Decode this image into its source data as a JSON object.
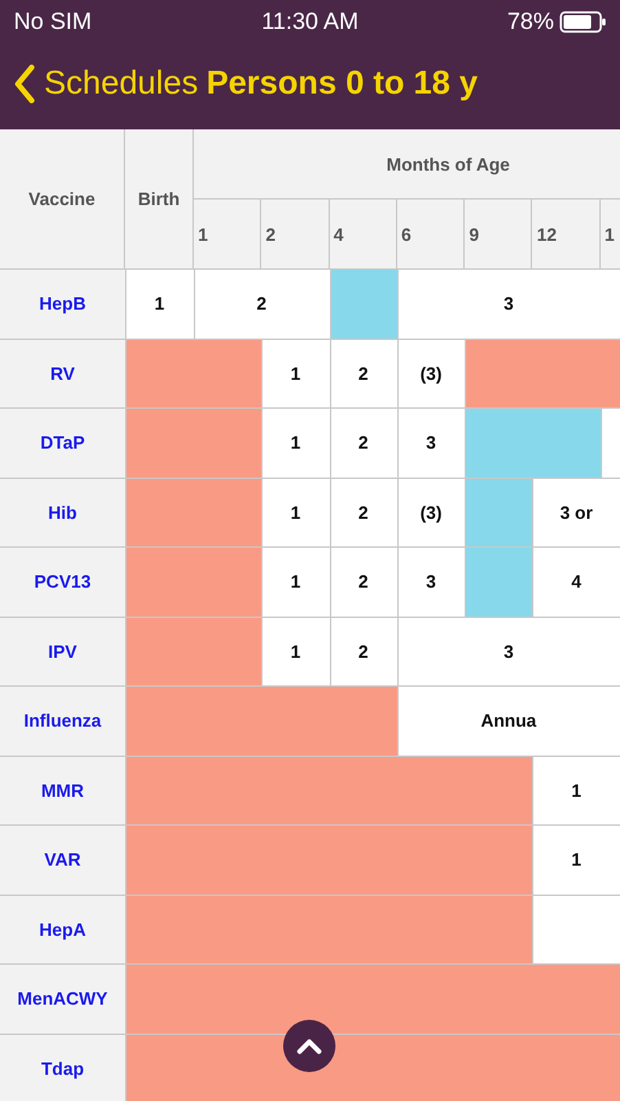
{
  "status_bar": {
    "carrier": "No SIM",
    "time": "11:30 AM",
    "battery": "78%"
  },
  "nav_bar": {
    "back_label": "Schedules",
    "title": "Persons 0 to 18 y"
  },
  "table": {
    "columns": {
      "vaccine": "Vaccine",
      "birth": "Birth",
      "months_heading": "Months of Age",
      "months": [
        "1",
        "2",
        "4",
        "6",
        "9",
        "12",
        "1"
      ]
    },
    "rows": [
      {
        "vaccine": "HepB",
        "cells": [
          {
            "kind": "dose",
            "joined": false,
            "text": "1"
          },
          {
            "kind": "dose",
            "joined": false,
            "text": "2"
          },
          {
            "kind": "dose",
            "joined": true
          },
          {
            "kind": "catchup",
            "joined": false
          },
          {
            "kind": "dose",
            "joined": false,
            "text": "3"
          },
          {
            "kind": "dose",
            "joined": true
          },
          {
            "kind": "dose",
            "joined": true
          },
          {
            "kind": "dose",
            "joined": true
          }
        ]
      },
      {
        "vaccine": "RV",
        "cells": [
          {
            "kind": "unrecommended",
            "joined": false
          },
          {
            "kind": "unrecommended",
            "joined": true
          },
          {
            "kind": "dose",
            "joined": false,
            "text": "1"
          },
          {
            "kind": "dose",
            "joined": false,
            "text": "2"
          },
          {
            "kind": "dose",
            "joined": false,
            "text": "(3)"
          },
          {
            "kind": "unrecommended",
            "joined": false
          },
          {
            "kind": "unrecommended",
            "joined": true
          },
          {
            "kind": "unrecommended",
            "joined": true
          }
        ]
      },
      {
        "vaccine": "DTaP",
        "cells": [
          {
            "kind": "unrecommended",
            "joined": false
          },
          {
            "kind": "unrecommended",
            "joined": true
          },
          {
            "kind": "dose",
            "joined": false,
            "text": "1"
          },
          {
            "kind": "dose",
            "joined": false,
            "text": "2"
          },
          {
            "kind": "dose",
            "joined": false,
            "text": "3"
          },
          {
            "kind": "catchup",
            "joined": false
          },
          {
            "kind": "catchup",
            "joined": true
          },
          {
            "kind": "dose",
            "joined": false
          }
        ]
      },
      {
        "vaccine": "Hib",
        "cells": [
          {
            "kind": "unrecommended",
            "joined": false
          },
          {
            "kind": "unrecommended",
            "joined": true
          },
          {
            "kind": "dose",
            "joined": false,
            "text": "1"
          },
          {
            "kind": "dose",
            "joined": false,
            "text": "2"
          },
          {
            "kind": "dose",
            "joined": false,
            "text": "(3)"
          },
          {
            "kind": "catchup",
            "joined": false
          },
          {
            "kind": "dose",
            "joined": false,
            "text": "3 or"
          },
          {
            "kind": "dose",
            "joined": true
          }
        ]
      },
      {
        "vaccine": "PCV13",
        "cells": [
          {
            "kind": "unrecommended",
            "joined": false
          },
          {
            "kind": "unrecommended",
            "joined": true
          },
          {
            "kind": "dose",
            "joined": false,
            "text": "1"
          },
          {
            "kind": "dose",
            "joined": false,
            "text": "2"
          },
          {
            "kind": "dose",
            "joined": false,
            "text": "3"
          },
          {
            "kind": "catchup",
            "joined": false
          },
          {
            "kind": "dose",
            "joined": false,
            "text": "4"
          },
          {
            "kind": "dose",
            "joined": true
          }
        ]
      },
      {
        "vaccine": "IPV",
        "cells": [
          {
            "kind": "unrecommended",
            "joined": false
          },
          {
            "kind": "unrecommended",
            "joined": true
          },
          {
            "kind": "dose",
            "joined": false,
            "text": "1"
          },
          {
            "kind": "dose",
            "joined": false,
            "text": "2"
          },
          {
            "kind": "dose",
            "joined": false,
            "text": "3"
          },
          {
            "kind": "dose",
            "joined": true
          },
          {
            "kind": "dose",
            "joined": true
          },
          {
            "kind": "dose",
            "joined": true
          }
        ]
      },
      {
        "vaccine": "Influenza",
        "cells": [
          {
            "kind": "unrecommended",
            "joined": false
          },
          {
            "kind": "unrecommended",
            "joined": true
          },
          {
            "kind": "unrecommended",
            "joined": true
          },
          {
            "kind": "unrecommended",
            "joined": true
          },
          {
            "kind": "dose",
            "joined": false,
            "text": "Annua"
          },
          {
            "kind": "dose",
            "joined": true
          },
          {
            "kind": "dose",
            "joined": true
          },
          {
            "kind": "dose",
            "joined": true
          }
        ]
      },
      {
        "vaccine": "MMR",
        "cells": [
          {
            "kind": "unrecommended",
            "joined": false
          },
          {
            "kind": "unrecommended",
            "joined": true
          },
          {
            "kind": "unrecommended",
            "joined": true
          },
          {
            "kind": "unrecommended",
            "joined": true
          },
          {
            "kind": "unrecommended",
            "joined": true
          },
          {
            "kind": "unrecommended",
            "joined": true
          },
          {
            "kind": "dose",
            "joined": false,
            "text": "1"
          },
          {
            "kind": "dose",
            "joined": true
          }
        ]
      },
      {
        "vaccine": "VAR",
        "cells": [
          {
            "kind": "unrecommended",
            "joined": false
          },
          {
            "kind": "unrecommended",
            "joined": true
          },
          {
            "kind": "unrecommended",
            "joined": true
          },
          {
            "kind": "unrecommended",
            "joined": true
          },
          {
            "kind": "unrecommended",
            "joined": true
          },
          {
            "kind": "unrecommended",
            "joined": true
          },
          {
            "kind": "dose",
            "joined": false,
            "text": "1"
          },
          {
            "kind": "dose",
            "joined": true
          }
        ]
      },
      {
        "vaccine": "HepA",
        "cells": [
          {
            "kind": "unrecommended",
            "joined": false
          },
          {
            "kind": "unrecommended",
            "joined": true
          },
          {
            "kind": "unrecommended",
            "joined": true
          },
          {
            "kind": "unrecommended",
            "joined": true
          },
          {
            "kind": "unrecommended",
            "joined": true
          },
          {
            "kind": "unrecommended",
            "joined": true
          },
          {
            "kind": "dose",
            "joined": false
          },
          {
            "kind": "dose",
            "joined": true
          }
        ]
      },
      {
        "vaccine": "MenACWY",
        "cells": [
          {
            "kind": "unrecommended",
            "joined": false
          },
          {
            "kind": "unrecommended",
            "joined": true
          },
          {
            "kind": "unrecommended",
            "joined": true
          },
          {
            "kind": "unrecommended",
            "joined": true
          },
          {
            "kind": "unrecommended",
            "joined": true
          },
          {
            "kind": "unrecommended",
            "joined": true
          },
          {
            "kind": "unrecommended",
            "joined": true
          },
          {
            "kind": "unrecommended",
            "joined": true
          }
        ]
      },
      {
        "vaccine": "Tdap",
        "cells": [
          {
            "kind": "unrecommended",
            "joined": false
          },
          {
            "kind": "unrecommended",
            "joined": true
          },
          {
            "kind": "unrecommended",
            "joined": true
          },
          {
            "kind": "unrecommended",
            "joined": true
          },
          {
            "kind": "unrecommended",
            "joined": true
          },
          {
            "kind": "unrecommended",
            "joined": true
          },
          {
            "kind": "unrecommended",
            "joined": true
          },
          {
            "kind": "unrecommended",
            "joined": true
          }
        ]
      }
    ]
  }
}
